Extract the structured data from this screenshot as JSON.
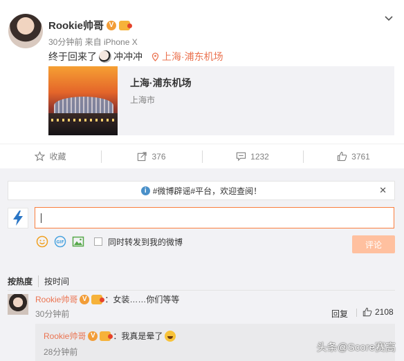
{
  "post": {
    "author": "Rookie帅哥",
    "verified_badge": "V",
    "meta": "30分钟前 来自 iPhone X",
    "text": "终于回来了",
    "text_after_emoji": "冲冲冲",
    "location_link": "上海·浦东机场",
    "location_card": {
      "title": "上海·浦东机场",
      "subtitle": "上海市"
    }
  },
  "actions": [
    {
      "label": "收藏",
      "icon": "star-icon"
    },
    {
      "label": "376",
      "icon": "forward-icon"
    },
    {
      "label": "1232",
      "icon": "comment-icon"
    },
    {
      "label": "3761",
      "icon": "thumbs-up-icon"
    }
  ],
  "comments": {
    "notice": "#微博辟谣#平台，欢迎查阅！",
    "compose": {
      "value": "",
      "also_forward_label": "同时转发到我的微博",
      "submit_label": "评论"
    },
    "sort_tabs": [
      "按热度",
      "按时间"
    ],
    "items": [
      {
        "author": "Rookie帅哥",
        "verified_badge": "V",
        "text": "：女装……你们等等",
        "time": "30分钟前",
        "reply_label": "回复",
        "likes": "2108",
        "sub_reply": {
          "author": "Rookie帅哥",
          "verified_badge": "V",
          "text": "：我真是晕了",
          "time": "28分钟前"
        }
      }
    ]
  },
  "watermark": "头条@Score赛高",
  "colors": {
    "accent": "#eb7350",
    "compose_border": "#fa7d3c",
    "submit_disabled": "#ffc09f",
    "badge": "#f29d38",
    "comment_bg": "#f2f2f5"
  }
}
